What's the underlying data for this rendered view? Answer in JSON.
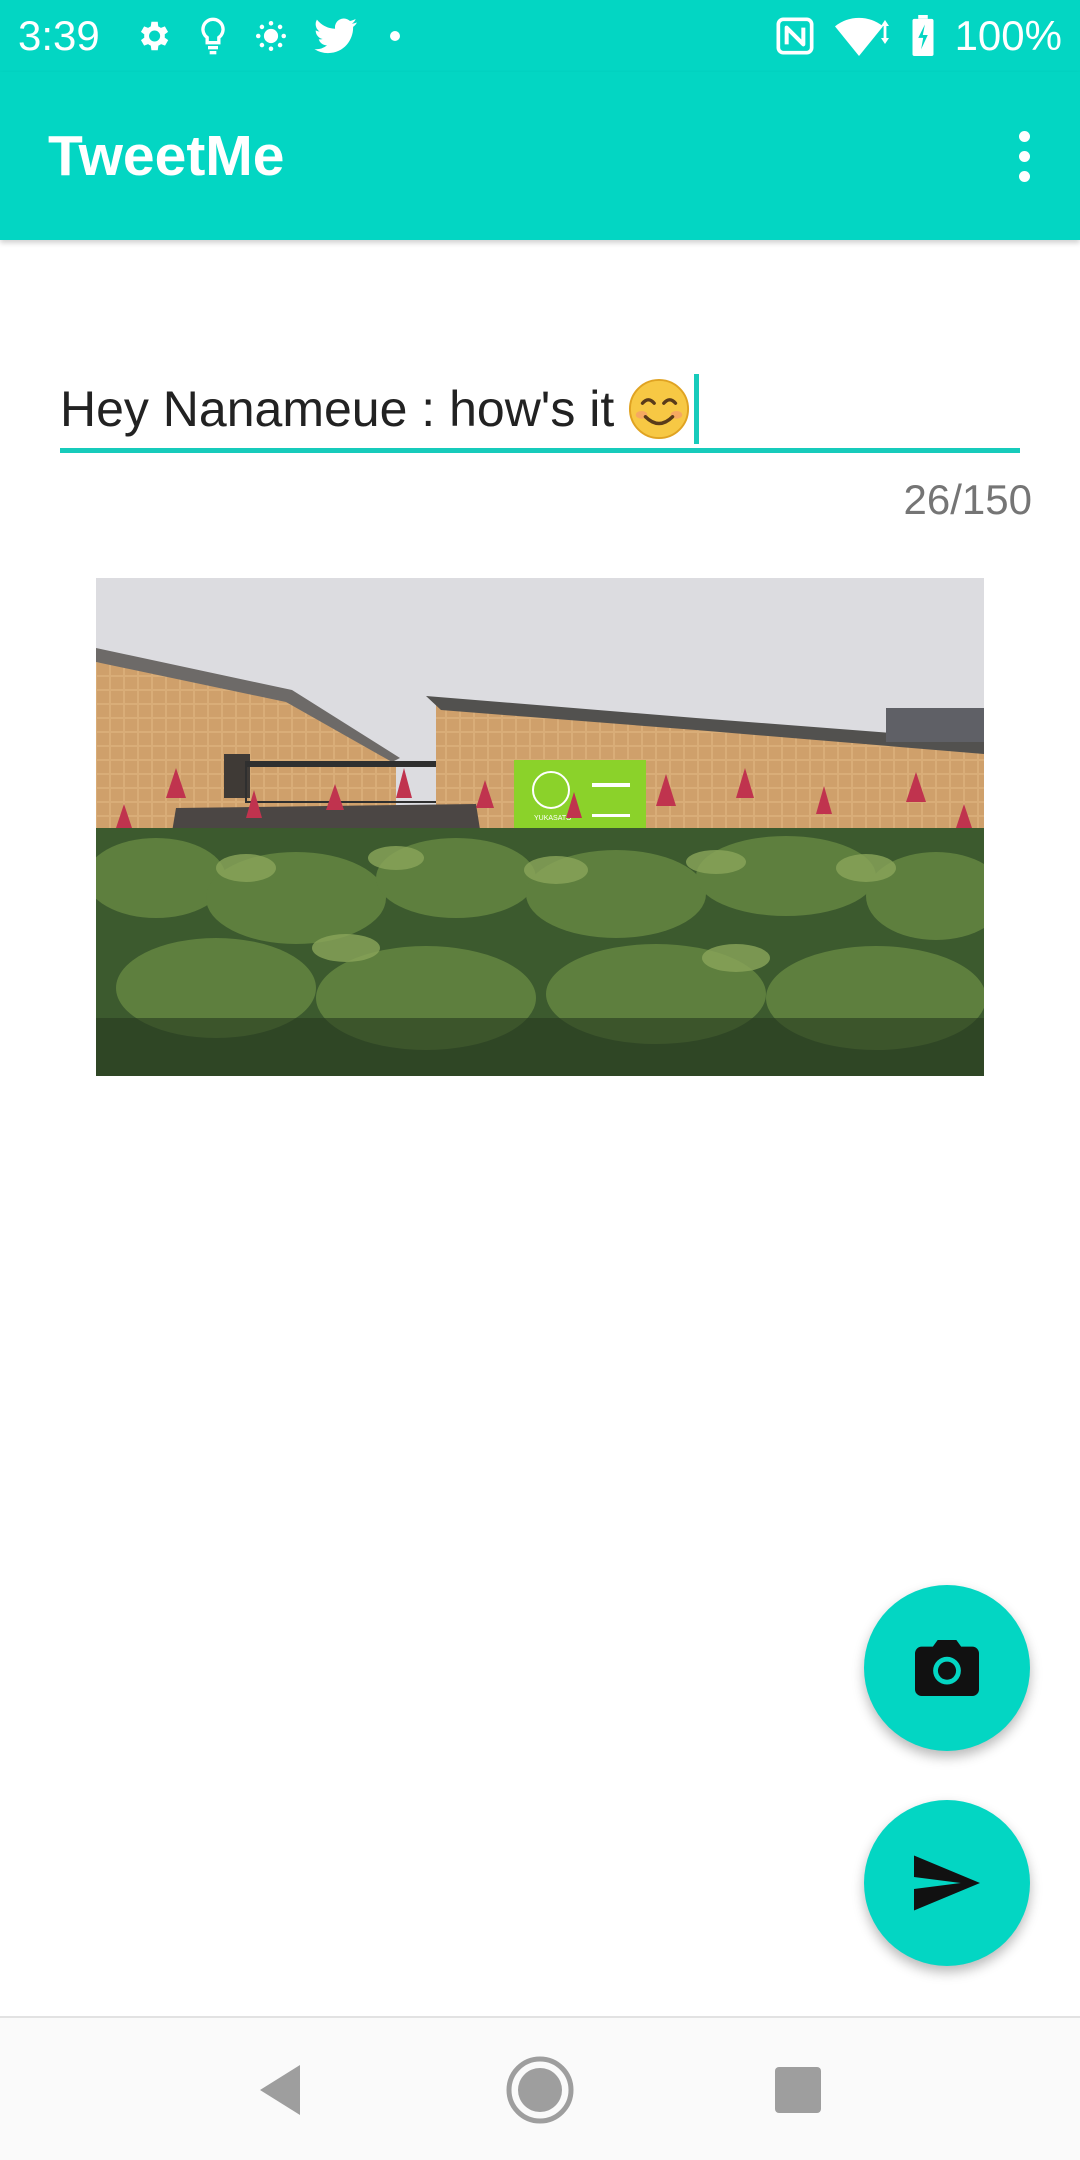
{
  "status_bar": {
    "time": "3:39",
    "battery_text": "100%",
    "left_icons": [
      "settings-icon",
      "lightbulb-icon",
      "brightness-icon",
      "twitter-icon",
      "notification-dot-icon"
    ],
    "right_icons": [
      "nfc-icon",
      "wifi-icon",
      "battery-charging-icon"
    ]
  },
  "app_bar": {
    "title": "TweetMe",
    "overflow_icon": "more-vert-icon"
  },
  "compose": {
    "text": "Hey Nanameue : how's it",
    "emoji": "smiling-face-icon",
    "char_counter": "26/150"
  },
  "photo": {
    "sign_text": "YUKASATO"
  },
  "fabs": {
    "camera_icon": "camera-icon",
    "send_icon": "send-icon"
  },
  "nav_bar": {
    "back_icon": "back-triangle-icon",
    "home_icon": "home-circle-icon",
    "recents_icon": "recents-square-icon"
  },
  "colors": {
    "accent": "#03d6c3",
    "underline": "#17cbbb",
    "text": "#222222",
    "counter": "#757575"
  }
}
